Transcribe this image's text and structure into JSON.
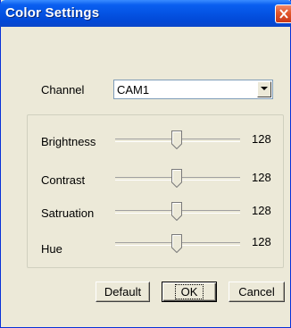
{
  "window": {
    "title": "Color Settings"
  },
  "channel": {
    "label": "Channel",
    "selected": "CAM1"
  },
  "sliders": [
    {
      "label": "Brightness",
      "value": "128",
      "level": 0.5
    },
    {
      "label": "Contrast",
      "value": "128",
      "level": 0.5
    },
    {
      "label": "Satruation",
      "value": "128",
      "level": 0.5
    },
    {
      "label": "Hue",
      "value": "128",
      "level": 0.5
    }
  ],
  "buttons": {
    "default_label": "Default",
    "ok_label": "OK",
    "cancel_label": "Cancel"
  },
  "colors": {
    "titlebar": "#0453e3",
    "close_button": "#e2572a",
    "dialog_face": "#ece9d8"
  },
  "icons": {
    "close": "close-icon",
    "dropdown": "chevron-down-icon",
    "slider_thumb": "slider-thumb-icon"
  }
}
